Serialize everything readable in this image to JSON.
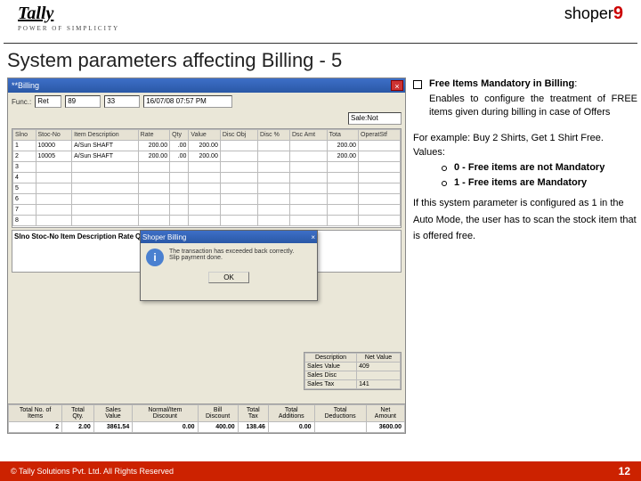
{
  "brand": {
    "tally": "Tally",
    "tally_tag": "POWER OF SIMPLICITY",
    "shoper": "shoper",
    "shoper9": "9"
  },
  "title": "System parameters affecting Billing - 5",
  "app": {
    "window_title": "**Billing",
    "fields": {
      "f1_label": "Func.:",
      "f1_val": "Ret",
      "f2_val": "89",
      "f3_val": "33",
      "f4_val": "16/07/08 07:57 PM",
      "sales_btn": "Sale:Not"
    },
    "grid_cols": [
      "Slno",
      "Stoc-No",
      "Item Description",
      "Rate",
      "Qty",
      "Value",
      "Disc Obj",
      "Disc %",
      "Dsc Amt",
      "Tota",
      "OperatStf"
    ],
    "grid_rows": [
      [
        "1",
        "10000",
        "A/Sun SHAFT",
        "200.00",
        ".00",
        "200.00",
        "",
        "",
        "",
        "200.00",
        ""
      ],
      [
        "2",
        "10005",
        "A/Sun SHAFT",
        "200.00",
        ".00",
        "200.00",
        "",
        "",
        "",
        "200.00",
        ""
      ],
      [
        "3",
        "",
        "",
        "",
        "",
        "",
        "",
        "",
        "",
        "",
        ""
      ],
      [
        "4",
        "",
        "",
        "",
        "",
        "",
        "",
        "",
        "",
        "",
        ""
      ],
      [
        "5",
        "",
        "",
        "",
        "",
        "",
        "",
        "",
        "",
        "",
        ""
      ],
      [
        "6",
        "",
        "",
        "",
        "",
        "",
        "",
        "",
        "",
        "",
        ""
      ],
      [
        "7",
        "",
        "",
        "",
        "",
        "",
        "",
        "",
        "",
        "",
        ""
      ],
      [
        "8",
        "",
        "",
        "",
        "",
        "",
        "",
        "",
        "",
        "",
        ""
      ]
    ],
    "dialog": {
      "title": "Shoper Billing",
      "msg1": "The transaction has exceeded back correctly.",
      "msg2": "Slip payment done.",
      "ok": "OK"
    },
    "summary_cols": [
      "Description",
      "Net Value"
    ],
    "summary_rows": [
      [
        "Sales Value",
        "409"
      ],
      [
        "Sales Disc",
        ""
      ],
      [
        "Sales Tax",
        "141"
      ]
    ],
    "totals_cols": [
      "Total No. of Items",
      "Total Qty.",
      "Sales Value",
      "Normal/Item Discount",
      "Bill Discount",
      "Total Tax",
      "Total Additions",
      "Total Deductions",
      "Net Amount"
    ],
    "totals_vals": [
      "2",
      "2.00",
      "3861.54",
      "0.00",
      "400.00",
      "138.46",
      "0.00",
      "",
      "3600.00"
    ]
  },
  "right": {
    "b1_title": "Free Items Mandatory in Billing",
    "b1_body": "Enables to configure the treatment of FREE items given during billing in case of Offers",
    "example_l1": "For example: Buy 2 Shirts, Get 1 Shirt Free.",
    "values": "Values:",
    "opt0": "0 - Free items are not Mandatory",
    "opt1": "1 - Free items are Mandatory",
    "para2": "If this system parameter is configured as 1 in the Auto Mode, the user has to scan the stock item that is offered free."
  },
  "footer": {
    "copyright": "© Tally Solutions Pvt. Ltd. All Rights Reserved",
    "page": "12"
  }
}
